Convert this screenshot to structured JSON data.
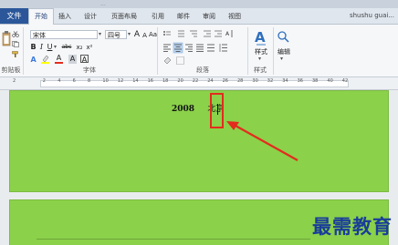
{
  "window": {
    "title_partial": "..."
  },
  "tabs": {
    "file": "文件",
    "items": [
      "开始",
      "插入",
      "设计",
      "页面布局",
      "引用",
      "邮件",
      "审阅",
      "视图"
    ]
  },
  "user": {
    "name": "shushu guai..."
  },
  "ribbon": {
    "font_group": {
      "label": "字体",
      "font_name": "宋体",
      "font_size": "四号",
      "grow_font": "A",
      "shrink_font": "A",
      "change_case": "Aa",
      "clear_format": "A",
      "bold": "B",
      "italic": "I",
      "underline": "U",
      "strikethrough": "abc",
      "subscript": "x₂",
      "superscript": "x²",
      "font_color": "A",
      "char_shading": "A",
      "char_border": "A",
      "highlight_color": "#ffff00",
      "font_color_value": "#e32c1e"
    },
    "paragraph_group": {
      "label": "段落"
    },
    "styles_group": {
      "label": "样式",
      "button": "样式"
    },
    "editing_group": {
      "label": "编辑",
      "button": "编辑"
    },
    "clipboard_group": {
      "label": "剪贴板"
    }
  },
  "ruler": {
    "ticks": [
      "2",
      "",
      "2",
      "4",
      "6",
      "8",
      "10",
      "12",
      "14",
      "16",
      "18",
      "20",
      "22",
      "24",
      "26",
      "28",
      "30",
      "32",
      "34",
      "36",
      "38",
      "40",
      "42"
    ]
  },
  "document": {
    "year": "2008",
    "city": "北京",
    "page_color": "#8bd14a"
  },
  "annotation": {
    "box_color": "#e32c1e"
  },
  "watermark": {
    "text": "最需教育"
  }
}
